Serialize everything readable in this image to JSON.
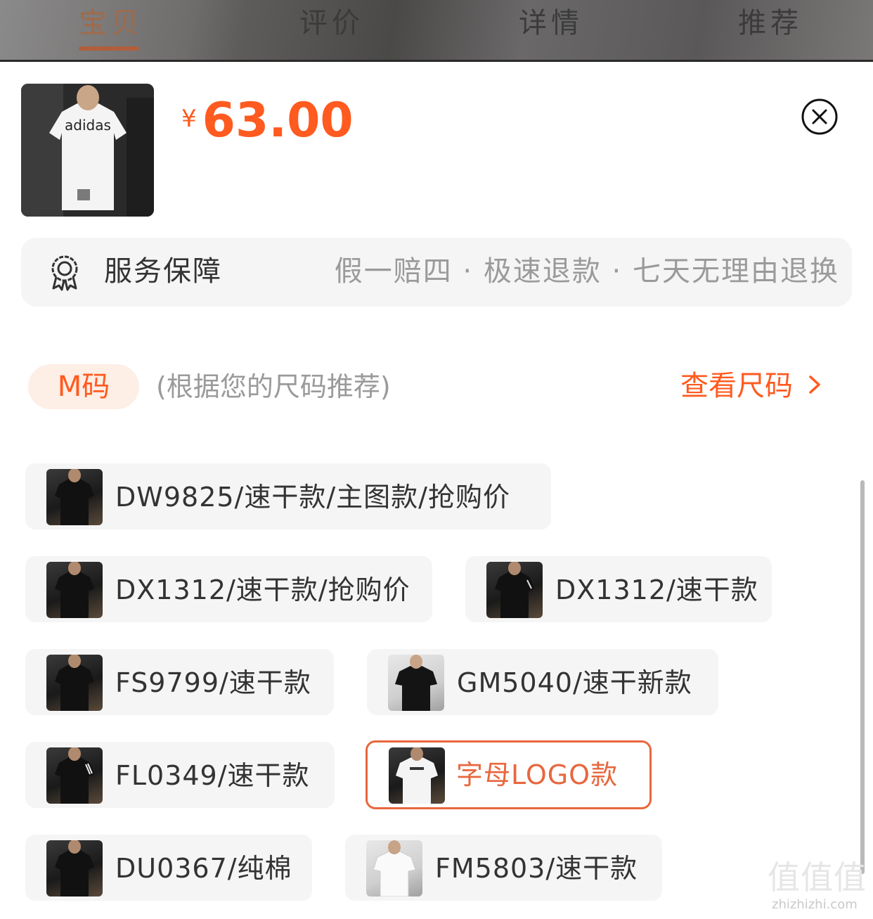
{
  "nav": {
    "tabs": [
      "宝贝",
      "评价",
      "详情",
      "推荐"
    ],
    "active_index": 0
  },
  "product": {
    "thumb_logo": "adidas",
    "currency_symbol": "¥",
    "price": "63.00"
  },
  "service": {
    "label": "服务保障",
    "description": "假一赔四 · 极速退款 · 七天无理由退换"
  },
  "size": {
    "selected_label": "M码",
    "hint": "(根据您的尺码推荐)",
    "chart_link": "查看尺码"
  },
  "options": [
    {
      "label": "DW9825/速干款/主图款/抢购价",
      "image": "black-tee",
      "selected": false
    },
    {
      "label": "DX1312/速干款/抢购价",
      "image": "black-tee",
      "selected": false
    },
    {
      "label": "DX1312/速干款",
      "image": "black-tee",
      "selected": false
    },
    {
      "label": "FS9799/速干款",
      "image": "black-tee",
      "selected": false
    },
    {
      "label": "GM5040/速干新款",
      "image": "black-tee",
      "selected": false
    },
    {
      "label": "FL0349/速干款",
      "image": "black-tee",
      "selected": false
    },
    {
      "label": "字母LOGO款",
      "image": "white-tee-logo",
      "selected": true
    },
    {
      "label": "DU0367/纯棉",
      "image": "black-tee",
      "selected": false
    },
    {
      "label": "FM5803/速干款",
      "image": "white-tee",
      "selected": false
    }
  ],
  "watermark": {
    "brand": "值值值",
    "url": "zhizhizhi.com"
  },
  "colors": {
    "accent": "#ff5a1f",
    "selected_border": "#e8673e",
    "chip_bg": "#f5f5f5"
  }
}
